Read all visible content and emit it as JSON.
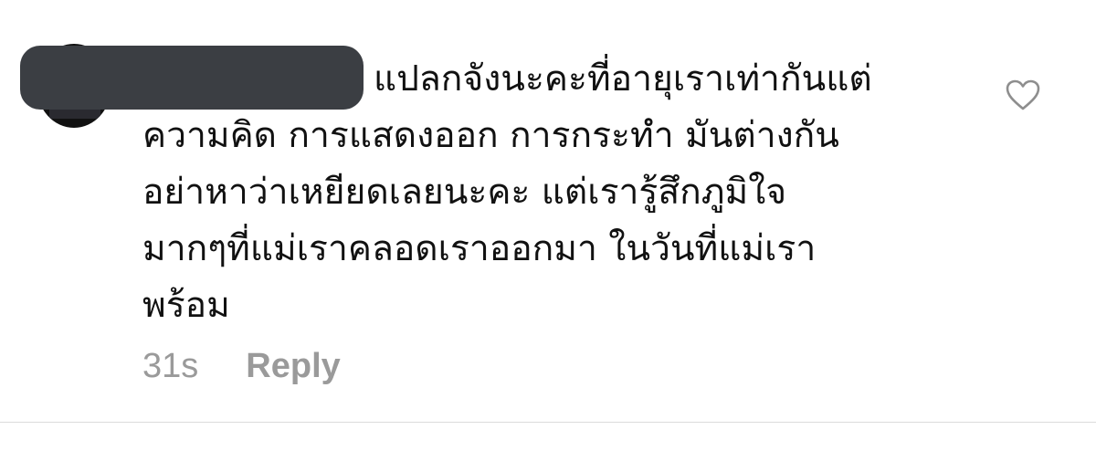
{
  "comment": {
    "lines": [
      "แปลกจังนะคะที่อายุเราเท่ากันแต่",
      "ความคิด การแสดงออก การกระทำ มันต่างกัน",
      "อย่าหาว่าเหยียดเลยนะคะ แต่เรารู้สึกภูมิใจ",
      "มากๆที่แม่เราคลอดเราออกมา ในวันที่แม่เรา",
      "พร้อม"
    ],
    "timestamp": "31s",
    "reply_label": "Reply",
    "like_icon": "heart-outline-icon"
  },
  "colors": {
    "text": "#111111",
    "meta": "#9a9a9a",
    "redaction": "#3b3e43",
    "divider": "#dbdbdb"
  }
}
